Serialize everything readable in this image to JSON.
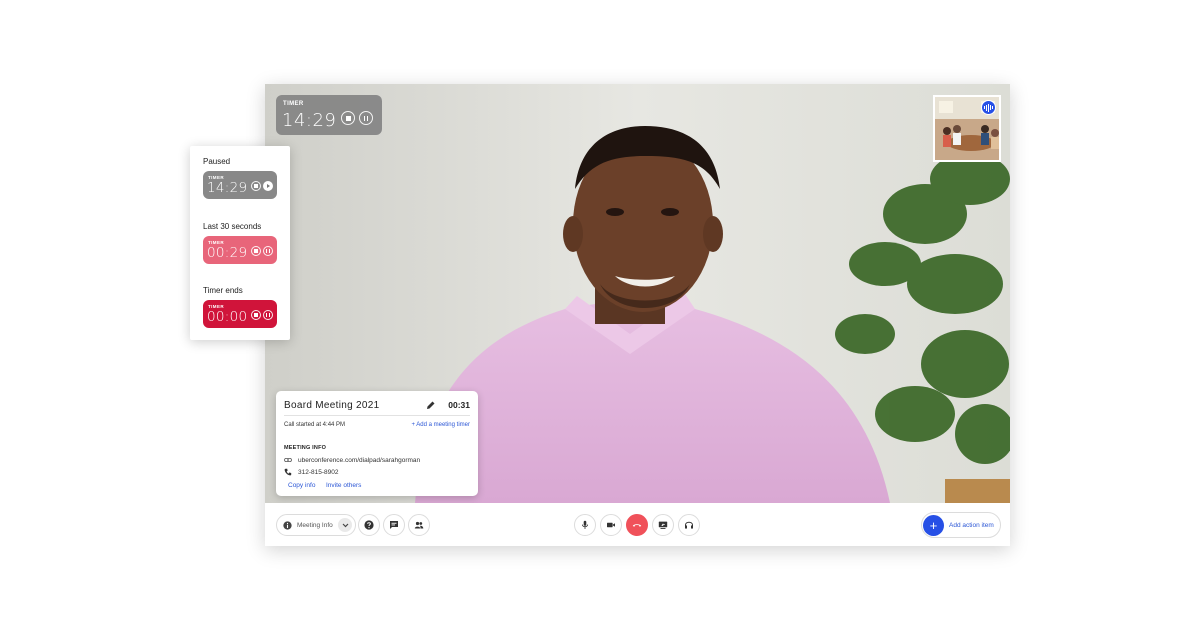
{
  "timer": {
    "label": "TIMER",
    "time": "14:29"
  },
  "meeting_card": {
    "title": "Board Meeting 2021",
    "elapsed": "00:31",
    "call_started": "Call started at 4:44 PM",
    "add_timer": "+ Add a meeting timer",
    "info_heading": "MEETING INFO",
    "link": "uberconference.com/dialpad/sarahgorman",
    "phone": "312-815-8902",
    "copy_info": "Copy info",
    "invite_others": "Invite others"
  },
  "controls": {
    "meeting_info": "Meeting Info",
    "add_action_item": "Add action item",
    "left_icons": [
      "help-icon",
      "chat-icon",
      "participants-icon"
    ],
    "center_icons": [
      "microphone-icon",
      "camera-icon",
      "hang-up-icon",
      "screen-share-icon",
      "headset-icon"
    ]
  },
  "timer_states": [
    {
      "label": "Paused",
      "timer_label": "TIMER",
      "time": "14:29",
      "state": "paused"
    },
    {
      "label": "Last 30 seconds",
      "timer_label": "TIMER",
      "time": "00:29",
      "state": "last-30"
    },
    {
      "label": "Timer ends",
      "timer_label": "TIMER",
      "time": "00:00",
      "state": "ended"
    }
  ],
  "colors": {
    "accent_blue": "#2750e6",
    "hang_up": "#f0515a",
    "timer_gray": "#888888",
    "timer_warning": "#e8657a",
    "timer_end": "#d0143a"
  }
}
